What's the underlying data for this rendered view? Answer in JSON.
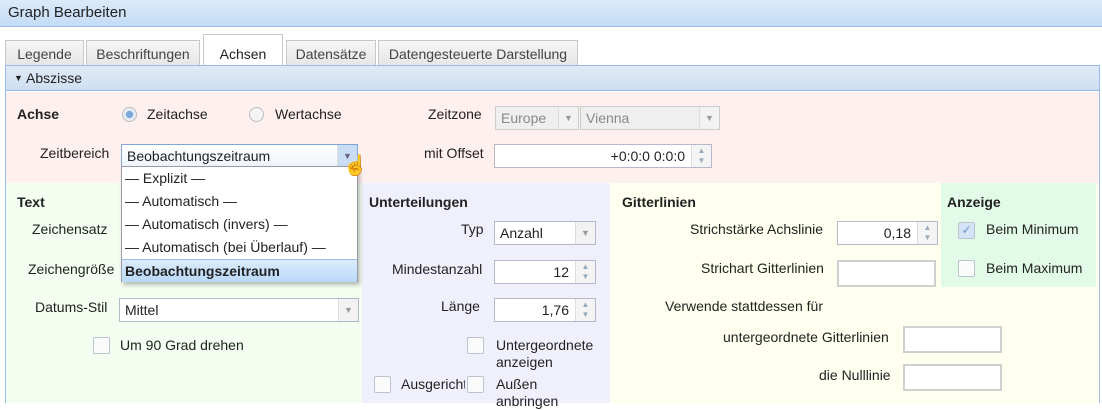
{
  "window": {
    "title": "Graph Bearbeiten"
  },
  "tabs": [
    {
      "label": "Legende"
    },
    {
      "label": "Beschriftungen"
    },
    {
      "label": "Achsen",
      "active": true
    },
    {
      "label": "Datensätze"
    },
    {
      "label": "Datengesteuerte Darstellung"
    }
  ],
  "section": {
    "title": "Abszisse",
    "icon": "triangle-down-icon"
  },
  "achse": {
    "label": "Achse",
    "options": [
      {
        "label": "Zeitachse",
        "selected": true
      },
      {
        "label": "Wertachse",
        "selected": false
      }
    ],
    "zeitzone_label": "Zeitzone",
    "zeitzone_region": "Europe",
    "zeitzone_city": "Vienna",
    "zeitbereich_label": "Zeitbereich",
    "zeitbereich_value": "Beobachtungszeitraum",
    "zeitbereich_options": [
      "— Explizit —",
      "— Automatisch —",
      "— Automatisch (invers) —",
      "— Automatisch (bei Überlauf) —",
      "Beobachtungszeitraum"
    ],
    "offset_label": "mit Offset",
    "offset_value": "+0:0:0 0:0:0"
  },
  "text": {
    "title": "Text",
    "zeichensatz_label": "Zeichensatz",
    "zeichengroesse_label": "Zeichengröße",
    "datumsstil_label": "Datums-Stil",
    "datumsstil_value": "Mittel",
    "rotate_label": "Um 90 Grad drehen",
    "rotate_checked": false
  },
  "unterteilungen": {
    "title": "Unterteilungen",
    "typ_label": "Typ",
    "typ_value": "Anzahl",
    "mindestanzahl_label": "Mindestanzahl",
    "mindestanzahl_value": "12",
    "laenge_label": "Länge",
    "laenge_value": "1,76",
    "untergeordnete_label": "Untergeordnete anzeigen",
    "ausgerichtet_label": "Ausgericht",
    "aussen_label": "Außen anbringen"
  },
  "gitterlinien": {
    "title": "Gitterlinien",
    "strichstaerke_label": "Strichstärke Achslinie",
    "strichstaerke_value": "0,18",
    "strichart_label": "Strichart Gitterlinien",
    "verwende_label": "Verwende stattdessen für",
    "untergeordnete_label": "untergeordnete Gitterlinien",
    "nulllinie_label": "die Nulllinie"
  },
  "anzeige": {
    "title": "Anzeige",
    "min_label": "Beim Minimum",
    "min_checked": true,
    "max_label": "Beim Maximum",
    "max_checked": false
  },
  "colors": {
    "achse_bg": "#fff0f0",
    "text_bg": "#f3fdf0",
    "unterteilungen_bg": "#f0f0fc",
    "gitterlinien_bg": "#fffff0",
    "anzeige_bg": "#e2fbe8",
    "accent": "#99bbe8"
  }
}
